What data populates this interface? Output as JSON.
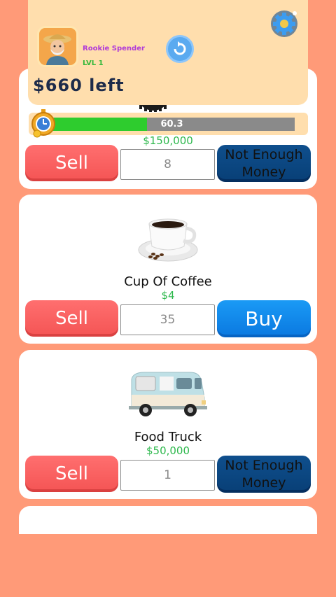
{
  "header": {
    "rank": "Rookie Spender",
    "level": "LVL 1",
    "balance": "$660 left"
  },
  "progress": {
    "label": "60.3",
    "fraction": 0.4
  },
  "items": [
    {
      "name": "",
      "price": "$150,000",
      "sell_label": "Sell",
      "quantity": "8",
      "action_label": "Not Enough Money",
      "action_state": "disabled"
    },
    {
      "name": "Cup Of Coffee",
      "price": "$4",
      "sell_label": "Sell",
      "quantity": "35",
      "action_label": "Buy",
      "action_state": "enabled"
    },
    {
      "name": "Food Truck",
      "price": "$50,000",
      "sell_label": "Sell",
      "quantity": "1",
      "action_label": "Not Enough Money",
      "action_state": "disabled"
    }
  ],
  "icons": {
    "avatar": "explorer-avatar",
    "refresh": "refresh-icon",
    "settings": "gear-icon",
    "timer": "stopwatch-icon",
    "item1": "tire-icon",
    "item2": "coffee-cup-icon",
    "item3": "food-truck-icon"
  },
  "colors": {
    "background": "#FF9A78",
    "header": "#FFDEAD",
    "sell": "#F45454",
    "buy": "#0A78E0",
    "disabled": "#0F4F8D",
    "price": "#2DB84C",
    "progress_fill": "#2ECC2E"
  }
}
